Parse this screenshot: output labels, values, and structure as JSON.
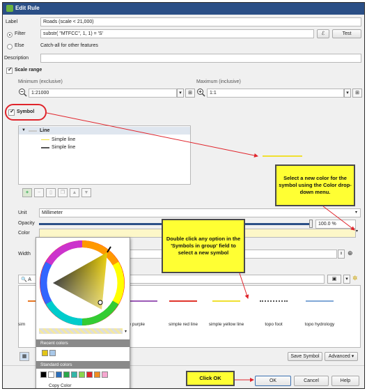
{
  "window": {
    "title": "Edit Rule"
  },
  "rule": {
    "label_text": "Label",
    "label_value": "Roads (scale < 21,000)",
    "filter_text": "Filter",
    "filter_value": "substr( \"MTFCC\", 1, 1) = 'S'",
    "epsilon": "ℰ",
    "test": "Test",
    "else_text": "Else",
    "else_desc": "Catch-all for other features",
    "description_text": "Description"
  },
  "scale": {
    "title": "Scale range",
    "min_label": "Minimum (exclusive)",
    "min_value": "1:21000",
    "max_label": "Maximum (inclusive)",
    "max_value": "1:1"
  },
  "symbol": {
    "title": "Symbol",
    "tree_root": "Line",
    "layer1": "Simple line",
    "layer2": "Simple line",
    "unit_label": "Unit",
    "unit_value": "Millimeter",
    "opacity_label": "Opacity",
    "opacity_value": "100.0 %",
    "color_label": "Color",
    "width_label": "Width"
  },
  "color_popup": {
    "recent_label": "Recent colors",
    "standard_label": "Standard colors",
    "copy_label": "Copy Color",
    "recent_colors": [
      "#e2c417",
      "#a8c8e8"
    ],
    "standard_colors": [
      "#000000",
      "#ffffff",
      "#2a6ebb",
      "#2ba84a",
      "#33b6a8",
      "#8ad44d",
      "#e0252b",
      "#f08d21",
      "#f6a7d0"
    ]
  },
  "library": {
    "search_placeholder": "A",
    "items": [
      {
        "label": "sim",
        "color": "#e87722"
      },
      {
        "label": "mple purple line",
        "color": "#9b59b6"
      },
      {
        "label": "simple red line",
        "color": "#e0342b"
      },
      {
        "label": "simple yellow line",
        "color": "#f0e030"
      },
      {
        "label": "topo foot",
        "color": "#555555"
      },
      {
        "label": "topo hydrology",
        "color": "#7fa7d6"
      }
    ]
  },
  "buttons": {
    "save_symbol": "Save Symbol",
    "advanced": "Advanced",
    "ok": "OK",
    "cancel": "Cancel",
    "help": "Help"
  },
  "callouts": {
    "color_callout": "Select a new color for the symbol using the Color drop-down menu.",
    "symbol_callout": "Double click any option in the 'Symbols in group' field to select a new symbol",
    "ok_callout": "Click OK"
  },
  "colors": {
    "highlight_red": "#e0242b",
    "callout_yellow": "#ffff33",
    "title_blue": "#2b4f86",
    "selected_color": "#fdf7c8"
  }
}
